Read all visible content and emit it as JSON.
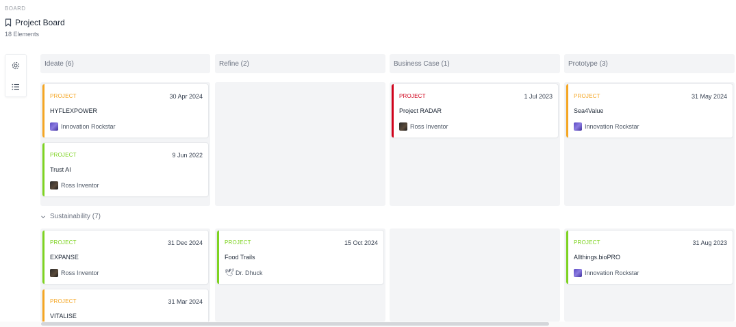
{
  "breadcrumb": "BOARD",
  "page": {
    "title": "Project Board",
    "count": "18 Elements"
  },
  "columns": [
    {
      "label": "Ideate (6)"
    },
    {
      "label": "Refine (2)"
    },
    {
      "label": "Business Case (1)"
    },
    {
      "label": "Prototype (3)"
    }
  ],
  "group": {
    "label": "Sustainability (7)"
  },
  "cards": [
    {
      "kind": "PROJECT",
      "date": "30 Apr 2024",
      "name": "HYFLEXPOWER",
      "owner": "Innovation Rockstar",
      "accent": "#f5a623"
    },
    {
      "kind": "PROJECT",
      "date": "9 Jun 2022",
      "name": "Trust AI",
      "owner": "Ross Inventor",
      "accent": "#7ed321"
    },
    {
      "kind": "PROJECT",
      "date": "1 Jul 2023",
      "name": "Project RADAR",
      "owner": "Ross Inventor",
      "accent": "#d0021b"
    },
    {
      "kind": "PROJECT",
      "date": "31 May 2024",
      "name": "Sea4Value",
      "owner": "Innovation Rockstar",
      "accent": "#f5a623"
    },
    {
      "kind": "PROJECT",
      "date": "31 Dec 2024",
      "name": "EXPANSE",
      "owner": "Ross Inventor",
      "accent": "#7ed321"
    },
    {
      "kind": "PROJECT",
      "date": "15 Oct 2024",
      "name": "Food Trails",
      "owner": "Dr. Dhuck",
      "accent": "#7ed321"
    },
    {
      "kind": "PROJECT",
      "date": "31 Aug 2023",
      "name": "Allthings.bioPRO",
      "owner": "Innovation Rockstar",
      "accent": "#7ed321"
    },
    {
      "kind": "PROJECT",
      "date": "31 Mar 2024",
      "name": "VITALISE",
      "owner": "",
      "accent": "#f5a623"
    }
  ],
  "icons": {
    "settings": "gear-icon",
    "list": "list-icon",
    "bookmark": "bookmark-icon",
    "collapse": "chevron-down-icon"
  }
}
